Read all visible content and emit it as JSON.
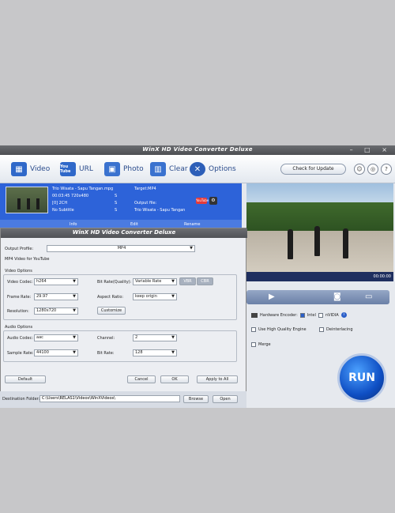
{
  "window": {
    "title": "WinX HD Video Converter Deluxe",
    "controls": "– □ ×"
  },
  "toolbar": {
    "video": "Video",
    "url": "URL",
    "photo": "Photo",
    "clear": "Clear",
    "options": "Options",
    "youtube_icon_text": "You Tube",
    "check_update": "Check for Update"
  },
  "file": {
    "name": "Trio Wisata - Sapu Tangan.mpg",
    "duration": "00:03:45  720x480",
    "audio": "[0] 2CH",
    "subtitle": "No Subtitle",
    "col_s1": "S",
    "col_s2": "S",
    "col_s3": "S",
    "target": "Target:MP4",
    "output_label": "Output file:",
    "output_name": "Trio Wisata - Sapu Tangan",
    "yt_badge": "YouTube",
    "row2_info": "Info",
    "row2_edit": "Edit",
    "row2_rename": "Rename"
  },
  "dialog": {
    "title": "WinX HD Video Converter Deluxe",
    "output_profile_label": "Output Profile:",
    "output_profile_value": "MP4",
    "profile_desc": "MP4 Video for YouTube",
    "video_options": "Video Options",
    "video_codec_label": "Video Codec:",
    "video_codec": "h264",
    "frame_rate_label": "Frame Rate:",
    "frame_rate": "29.97",
    "resolution_label": "Resolution:",
    "resolution": "1280x720",
    "bitrate_label": "Bit Rate(Quality):",
    "bitrate": "Variable Rate",
    "vbr": "VBR",
    "cbr": "CBR",
    "aspect_label": "Aspect Ratio:",
    "aspect": "keep origin",
    "customize": "Customize",
    "audio_options": "Audio Options",
    "audio_codec_label": "Audio Codec:",
    "audio_codec": "aac",
    "sample_rate_label": "Sample Rate:",
    "sample_rate": "44100",
    "channel_label": "Channel:",
    "channel": "2",
    "audio_bitrate_label": "Bit Rate:",
    "audio_bitrate": "128",
    "default_btn": "Default",
    "cancel_btn": "Cancel",
    "ok_btn": "OK",
    "apply_all_btn": "Apply to All"
  },
  "destination": {
    "label": "Destination Folder:",
    "path": "C:\\Users\\RELAS1\\Videos\\WinXVideos\\",
    "browse": "Browse",
    "open": "Open"
  },
  "preview": {
    "time": "00:00:00"
  },
  "options_panel": {
    "hw_encoder": "Hardware Encoder:",
    "intel": "Intel",
    "nvidia": "nVIDIA",
    "high_quality": "Use High Quality Engine",
    "deinterlacing": "Deinterlacing",
    "merge": "Merge"
  },
  "run_label": "RUN"
}
